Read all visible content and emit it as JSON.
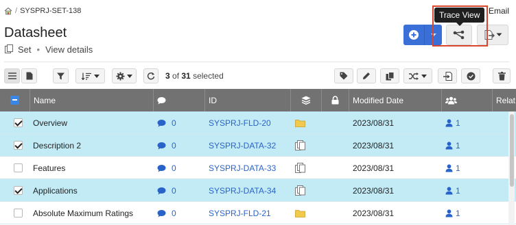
{
  "breadcrumb": {
    "separator": "/",
    "project": "SYSPRJ-SET-138"
  },
  "header": {
    "email_label": "Email",
    "title": "Datasheet",
    "set_label": "Set",
    "details_label": "View details"
  },
  "tooltip": {
    "text": "Trace View"
  },
  "toolbar": {
    "selected_count": "3",
    "selected_of": " of ",
    "total": "31",
    "selected_suffix": " selected"
  },
  "table": {
    "columns": {
      "name": "Name",
      "id": "ID",
      "modified": "Modified Date",
      "relations_partial": "Relat"
    },
    "rows": [
      {
        "checked": true,
        "name": "Overview",
        "comments": "0",
        "id": "SYSPRJ-FLD-20",
        "type": "folder",
        "modified": "2023/08/31",
        "users": "1"
      },
      {
        "checked": true,
        "name": "Description 2",
        "comments": "0",
        "id": "SYSPRJ-DATA-32",
        "type": "dataset",
        "modified": "2023/08/31",
        "users": "1"
      },
      {
        "checked": false,
        "name": "Features",
        "comments": "0",
        "id": "SYSPRJ-DATA-33",
        "type": "dataset",
        "modified": "2023/08/31",
        "users": "1"
      },
      {
        "checked": true,
        "name": "Applications",
        "comments": "0",
        "id": "SYSPRJ-DATA-34",
        "type": "dataset",
        "modified": "2023/08/31",
        "users": "1"
      },
      {
        "checked": false,
        "name": "Absolute Maximum Ratings",
        "comments": "0",
        "id": "SYSPRJ-FLD-21",
        "type": "folder",
        "modified": "2023/08/31",
        "users": "1"
      }
    ]
  },
  "colors": {
    "primary": "#3a6fd8",
    "header_bg": "#727272",
    "selected_row": "#c2ebf6",
    "link": "#2a63c7",
    "highlight": "#d9452b",
    "folder": "#f2c94c"
  },
  "icons": [
    "home-icon",
    "set-icon",
    "plus-icon",
    "chevron-down-icon",
    "trace-view-icon",
    "export-icon",
    "list-view-icon",
    "document-view-icon",
    "filter-icon",
    "sort-icon",
    "gear-icon",
    "refresh-icon",
    "tag-icon",
    "pencil-icon",
    "copy-icon",
    "shuffle-icon",
    "import-icon",
    "check-circle-icon",
    "trash-icon",
    "comment-icon",
    "stack-icon",
    "lock-icon",
    "users-icon",
    "user-icon",
    "folder-icon",
    "dataset-icon"
  ]
}
